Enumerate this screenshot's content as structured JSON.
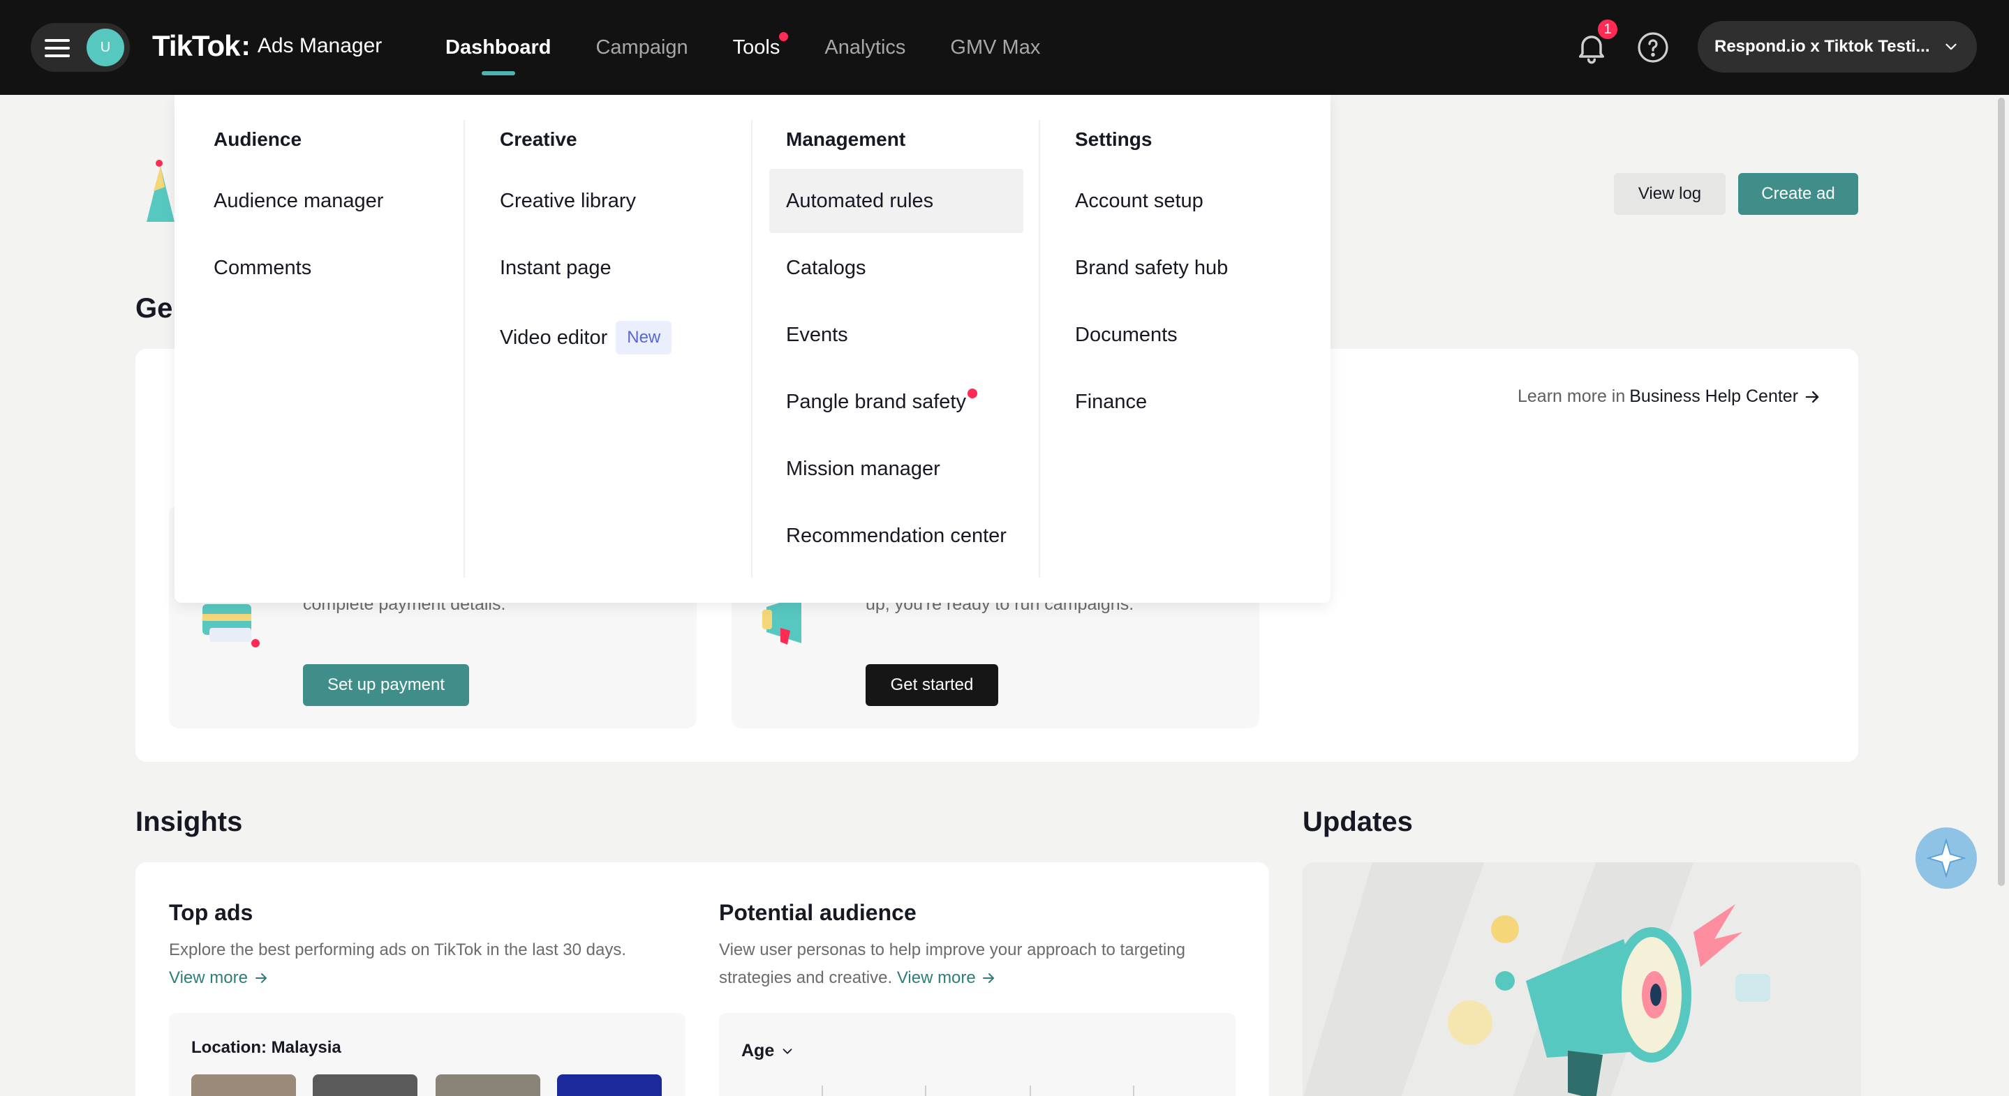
{
  "topbar": {
    "avatar_initial": "U",
    "logo_brand": "TikTok",
    "logo_colon": ":",
    "logo_product": "Ads Manager",
    "nav": [
      {
        "label": "Dashboard"
      },
      {
        "label": "Campaign"
      },
      {
        "label": "Tools"
      },
      {
        "label": "Analytics"
      },
      {
        "label": "GMV Max"
      }
    ],
    "notification_count": "1",
    "account_name": "Respond.io x Tiktok Testi..."
  },
  "header_actions": {
    "view_log": "View log",
    "create_ad": "Create ad"
  },
  "get_started": {
    "heading_fragment": "Ge",
    "learn_more_prefix": "Learn more in",
    "learn_more_link": "Business Help Center",
    "card_payment": {
      "description": "complete payment details.",
      "button": "Set up payment"
    },
    "card_campaign": {
      "description": "up, you're ready to run campaigns.",
      "button": "Get started"
    }
  },
  "insights": {
    "heading": "Insights",
    "top_ads": {
      "title": "Top ads",
      "description": "Explore the best performing ads on TikTok in the last 30 days.",
      "link": "View more",
      "location_label": "Location: Malaysia"
    },
    "potential_audience": {
      "title": "Potential audience",
      "description_line1": "View user personas to help improve your approach to targeting",
      "description_line2": "strategies and creative.",
      "link": "View more",
      "filter": "Age"
    }
  },
  "updates": {
    "heading": "Updates"
  },
  "tools_menu": {
    "columns": [
      {
        "heading": "Audience",
        "items": [
          {
            "label": "Audience manager"
          },
          {
            "label": "Comments"
          }
        ]
      },
      {
        "heading": "Creative",
        "items": [
          {
            "label": "Creative library"
          },
          {
            "label": "Instant page"
          },
          {
            "label": "Video editor",
            "badge": "New"
          }
        ]
      },
      {
        "heading": "Management",
        "items": [
          {
            "label": "Automated rules"
          },
          {
            "label": "Catalogs"
          },
          {
            "label": "Events"
          },
          {
            "label": "Pangle brand safety"
          },
          {
            "label": "Mission manager"
          },
          {
            "label": "Recommendation center"
          }
        ]
      },
      {
        "heading": "Settings",
        "items": [
          {
            "label": "Account setup"
          },
          {
            "label": "Brand safety hub"
          },
          {
            "label": "Documents"
          },
          {
            "label": "Finance"
          }
        ]
      }
    ]
  },
  "colors": {
    "topbar_bg": "#121212",
    "accent_teal": "#3f8e8a",
    "notification_red": "#fe2c55",
    "new_badge_bg": "#eaeefd"
  }
}
